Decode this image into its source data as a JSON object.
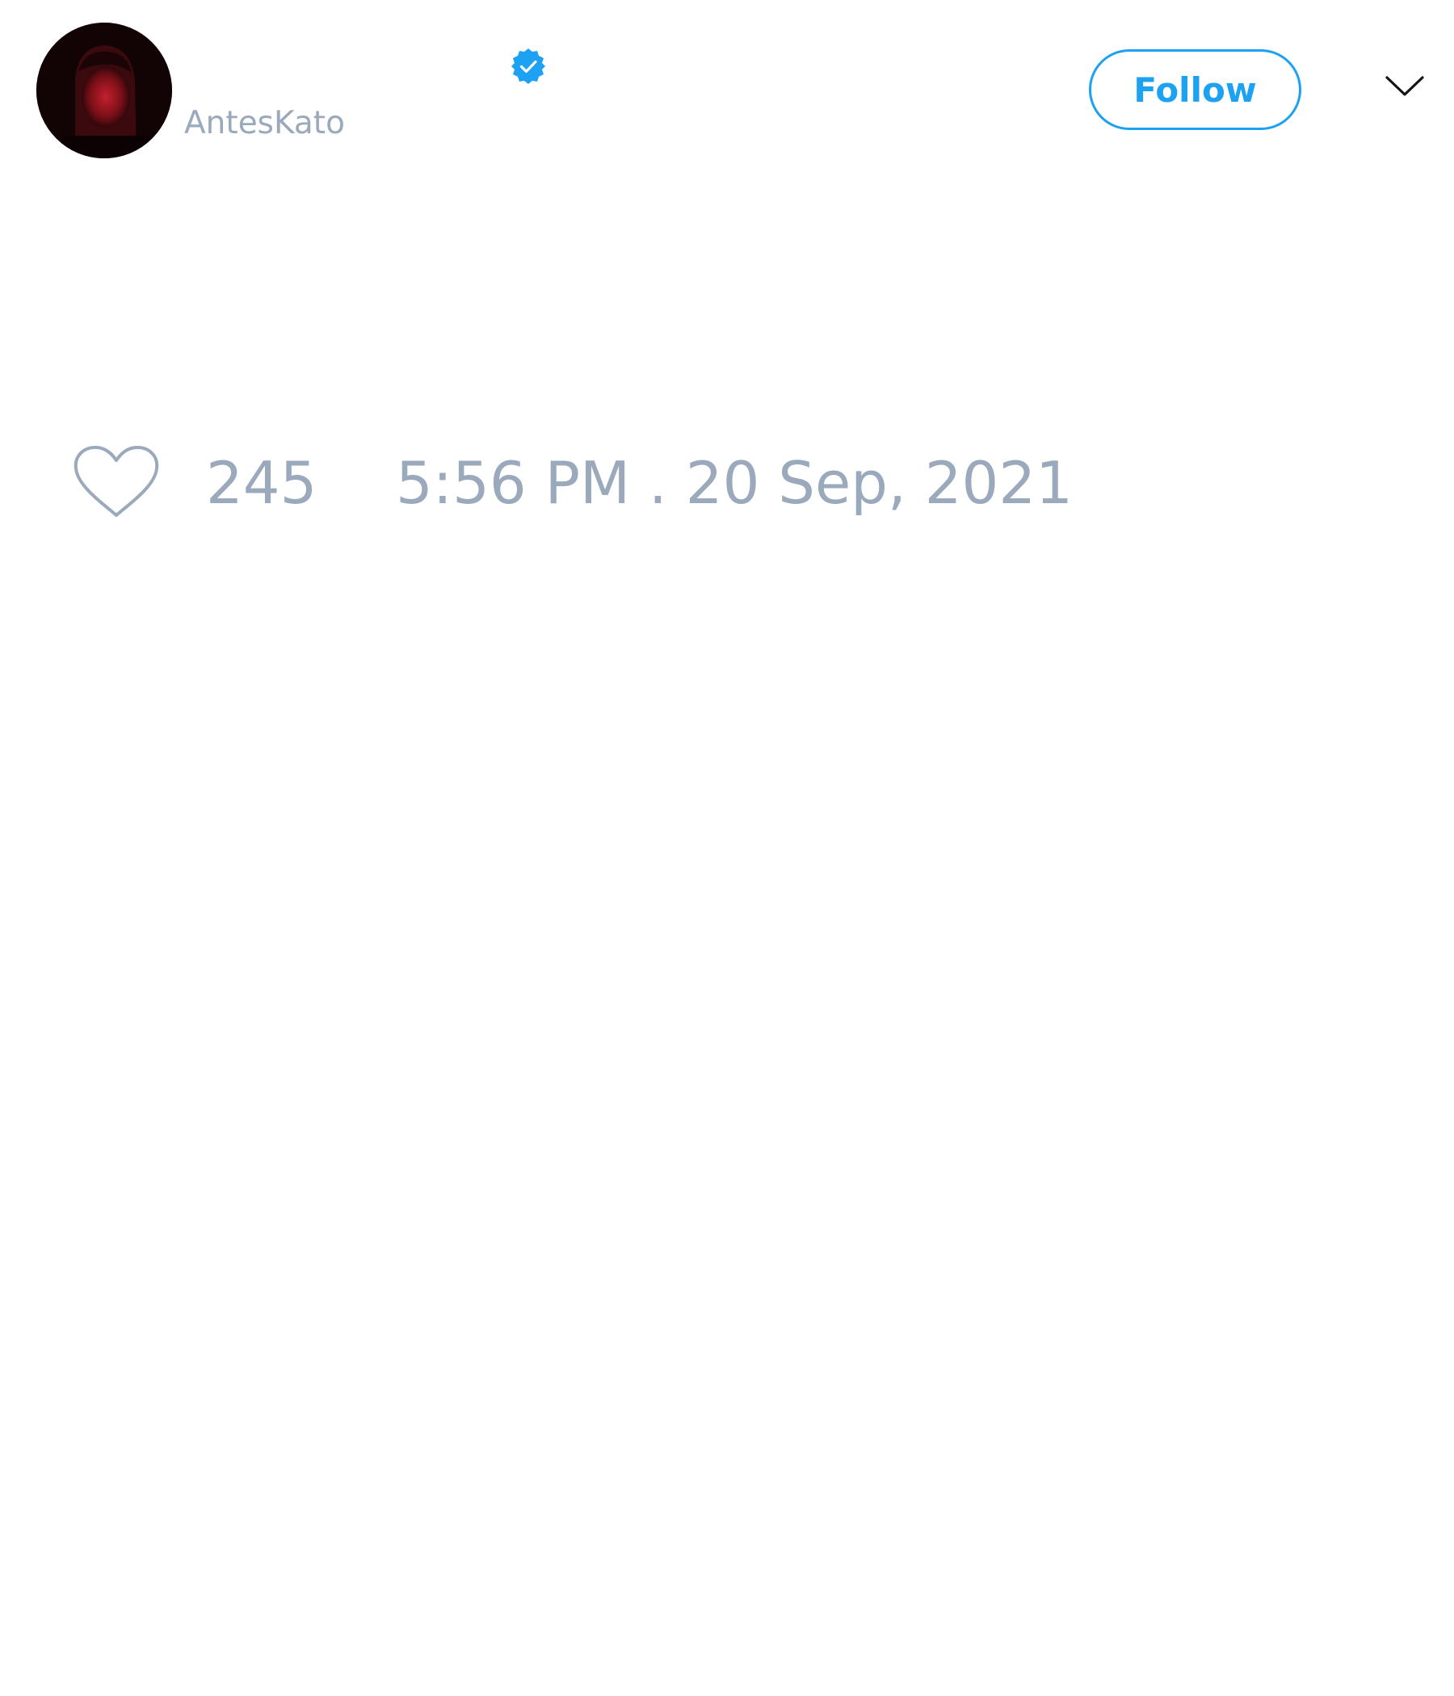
{
  "tweet": {
    "author": {
      "handle": "AntesKato",
      "avatar_icon": "user-avatar-photo",
      "verified_icon": "verified-badge-icon"
    },
    "follow_label": "Follow",
    "menu_icon": "chevron-down-icon",
    "like_icon": "heart-icon",
    "like_count": "245",
    "timestamp": "5:56 PM . 20 Sep, 2021"
  },
  "colors": {
    "accent": "#1da1f2",
    "muted_text": "#9aa9bb",
    "background": "#ffffff"
  }
}
